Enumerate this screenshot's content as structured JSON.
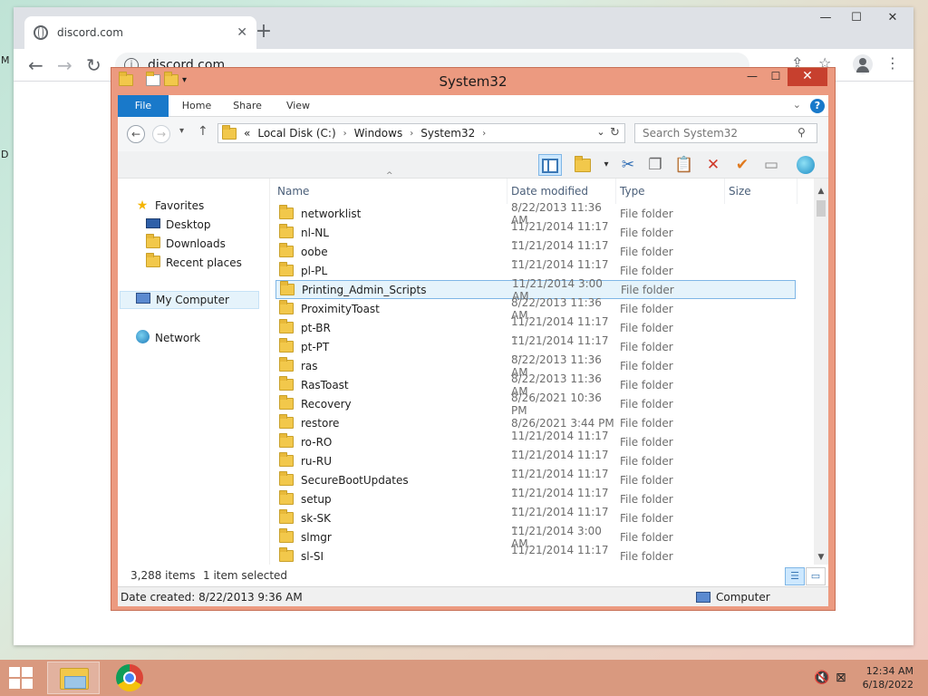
{
  "desktop": {
    "stray_text_1": "M",
    "stray_text_2": "D"
  },
  "browser": {
    "tab_title": "discord.com",
    "tab_close": "✕",
    "new_tab": "+",
    "url": "discord.com",
    "win_min": "—",
    "win_max": "☐",
    "win_close": "✕",
    "back": "←",
    "forward": "→",
    "reload": "↻",
    "info": "i",
    "share": "⇪",
    "bookmark": "☆",
    "menu": "⋮"
  },
  "explorer": {
    "title": "System32",
    "qat_dropdown": "▾",
    "win_min": "—",
    "win_max": "☐",
    "win_close": "✕",
    "ribbon": {
      "tabs": [
        "File",
        "Home",
        "Share",
        "View"
      ],
      "chevron": "⌄",
      "help": "?"
    },
    "address": {
      "back": "←",
      "forward": "→",
      "recent": "▾",
      "up": "↑",
      "overflow": "«",
      "crumbs": [
        "Local Disk (C:)",
        "Windows",
        "System32"
      ],
      "crumb_sep": "›",
      "dropdown": "⌄",
      "refresh": "↻",
      "search_placeholder": "Search System32",
      "search_icon": "⚲"
    },
    "navpane": {
      "favorites": "Favorites",
      "desktop": "Desktop",
      "downloads": "Downloads",
      "recent_places": "Recent places",
      "my_computer": "My Computer",
      "network": "Network"
    },
    "columns": {
      "name": "Name",
      "date_modified": "Date modified",
      "type": "Type",
      "size": "Size",
      "sort_caret": "^"
    },
    "files": [
      {
        "name": "networklist",
        "date": "8/22/2013 11:36 AM",
        "type": "File folder"
      },
      {
        "name": "nl-NL",
        "date": "11/21/2014 11:17 ...",
        "type": "File folder"
      },
      {
        "name": "oobe",
        "date": "11/21/2014 11:17 ...",
        "type": "File folder"
      },
      {
        "name": "pl-PL",
        "date": "11/21/2014 11:17 ...",
        "type": "File folder"
      },
      {
        "name": "Printing_Admin_Scripts",
        "date": "11/21/2014 3:00 AM",
        "type": "File folder"
      },
      {
        "name": "ProximityToast",
        "date": "8/22/2013 11:36 AM",
        "type": "File folder"
      },
      {
        "name": "pt-BR",
        "date": "11/21/2014 11:17 ...",
        "type": "File folder"
      },
      {
        "name": "pt-PT",
        "date": "11/21/2014 11:17 ...",
        "type": "File folder"
      },
      {
        "name": "ras",
        "date": "8/22/2013 11:36 AM",
        "type": "File folder"
      },
      {
        "name": "RasToast",
        "date": "8/22/2013 11:36 AM",
        "type": "File folder"
      },
      {
        "name": "Recovery",
        "date": "8/26/2021 10:36 PM",
        "type": "File folder"
      },
      {
        "name": "restore",
        "date": "8/26/2021 3:44 PM",
        "type": "File folder"
      },
      {
        "name": "ro-RO",
        "date": "11/21/2014 11:17 ...",
        "type": "File folder"
      },
      {
        "name": "ru-RU",
        "date": "11/21/2014 11:17 ...",
        "type": "File folder"
      },
      {
        "name": "SecureBootUpdates",
        "date": "11/21/2014 11:17 ...",
        "type": "File folder"
      },
      {
        "name": "setup",
        "date": "11/21/2014 11:17 ...",
        "type": "File folder"
      },
      {
        "name": "sk-SK",
        "date": "11/21/2014 11:17 ...",
        "type": "File folder"
      },
      {
        "name": "slmgr",
        "date": "11/21/2014 3:00 AM",
        "type": "File folder"
      },
      {
        "name": "sl-SI",
        "date": "11/21/2014 11:17 ...",
        "type": "File folder"
      }
    ],
    "selected_index": 4,
    "scroll": {
      "up": "▲",
      "down": "▼"
    },
    "status": {
      "item_count": "3,288 items",
      "selection": "1 item selected",
      "details_view": "☰",
      "large_icons": "▭"
    },
    "details": {
      "date_created": "Date created: 8/22/2013 9:36 AM",
      "location": "Computer"
    }
  },
  "taskbar": {
    "volume_icon": "🔇",
    "network_icon": "⊠",
    "time": "12:34 AM",
    "date": "6/18/2022"
  }
}
